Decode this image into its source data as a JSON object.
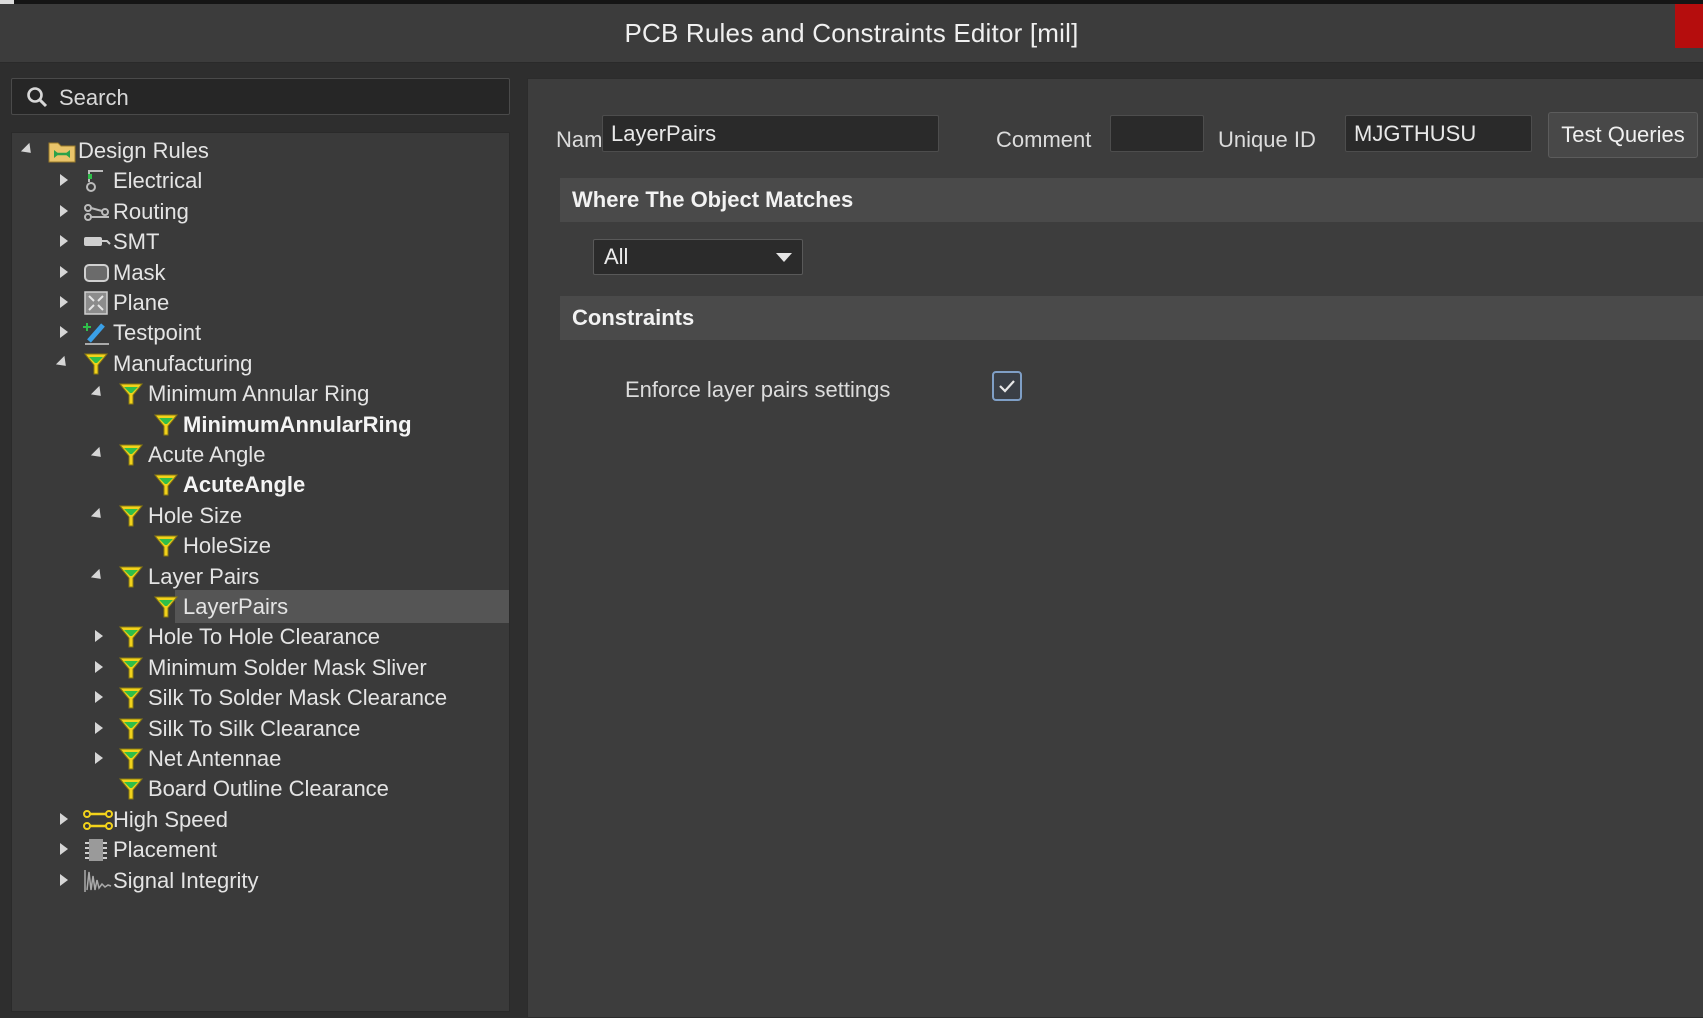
{
  "window": {
    "title": "PCB Rules and Constraints Editor [mil]"
  },
  "search": {
    "placeholder": "Search"
  },
  "tree": [
    {
      "label": "Design Rules",
      "level": 0,
      "expander": "down",
      "icon": "design-rules-folder-icon"
    },
    {
      "label": "Electrical",
      "level": 1,
      "expander": "right",
      "icon": "electrical-icon"
    },
    {
      "label": "Routing",
      "level": 1,
      "expander": "right",
      "icon": "routing-icon"
    },
    {
      "label": "SMT",
      "level": 1,
      "expander": "right",
      "icon": "smt-icon"
    },
    {
      "label": "Mask",
      "level": 1,
      "expander": "right",
      "icon": "mask-icon"
    },
    {
      "label": "Plane",
      "level": 1,
      "expander": "right",
      "icon": "plane-icon"
    },
    {
      "label": "Testpoint",
      "level": 1,
      "expander": "right",
      "icon": "testpoint-icon"
    },
    {
      "label": "Manufacturing",
      "level": 1,
      "expander": "down",
      "icon": "rule-funnel-icon"
    },
    {
      "label": "Minimum Annular Ring",
      "level": 2,
      "expander": "down",
      "icon": "rule-funnel-icon"
    },
    {
      "label": "MinimumAnnularRing",
      "level": 3,
      "expander": "none",
      "icon": "rule-funnel-icon",
      "bold": true
    },
    {
      "label": "Acute Angle",
      "level": 2,
      "expander": "down",
      "icon": "rule-funnel-icon"
    },
    {
      "label": "AcuteAngle",
      "level": 3,
      "expander": "none",
      "icon": "rule-funnel-icon",
      "bold": true
    },
    {
      "label": "Hole Size",
      "level": 2,
      "expander": "down",
      "icon": "rule-funnel-icon"
    },
    {
      "label": "HoleSize",
      "level": 3,
      "expander": "none",
      "icon": "rule-funnel-icon"
    },
    {
      "label": "Layer Pairs",
      "level": 2,
      "expander": "down",
      "icon": "rule-funnel-icon"
    },
    {
      "label": "LayerPairs",
      "level": 3,
      "expander": "none",
      "icon": "rule-funnel-icon",
      "selected": true
    },
    {
      "label": "Hole To Hole Clearance",
      "level": 2,
      "expander": "right",
      "icon": "rule-funnel-icon"
    },
    {
      "label": "Minimum Solder Mask Sliver",
      "level": 2,
      "expander": "right",
      "icon": "rule-funnel-icon"
    },
    {
      "label": "Silk To Solder Mask Clearance",
      "level": 2,
      "expander": "right",
      "icon": "rule-funnel-icon"
    },
    {
      "label": "Silk To Silk Clearance",
      "level": 2,
      "expander": "right",
      "icon": "rule-funnel-icon"
    },
    {
      "label": "Net Antennae",
      "level": 2,
      "expander": "right",
      "icon": "rule-funnel-icon"
    },
    {
      "label": "Board Outline Clearance",
      "level": 2,
      "expander": "none",
      "icon": "rule-funnel-icon"
    },
    {
      "label": "High Speed",
      "level": 1,
      "expander": "right",
      "icon": "high-speed-icon"
    },
    {
      "label": "Placement",
      "level": 1,
      "expander": "right",
      "icon": "placement-icon"
    },
    {
      "label": "Signal Integrity",
      "level": 1,
      "expander": "right",
      "icon": "signal-integrity-icon"
    }
  ],
  "form": {
    "name_label": "Name",
    "name_value": "LayerPairs",
    "comment_label": "Comment",
    "comment_value": "",
    "uid_label": "Unique ID",
    "uid_value": "MJGTHUSU",
    "test_queries": "Test Queries"
  },
  "where": {
    "header": "Where The Object Matches",
    "dropdown_value": "All"
  },
  "constraints": {
    "header": "Constraints",
    "enforce_label": "Enforce layer pairs settings",
    "enforce_checked": true
  },
  "colors": {
    "accent_red": "#b50d0d",
    "funnel_yellow": "#f2d21b",
    "funnel_green": "#2fbf4a",
    "checkbox_border": "#7f9fc6"
  }
}
